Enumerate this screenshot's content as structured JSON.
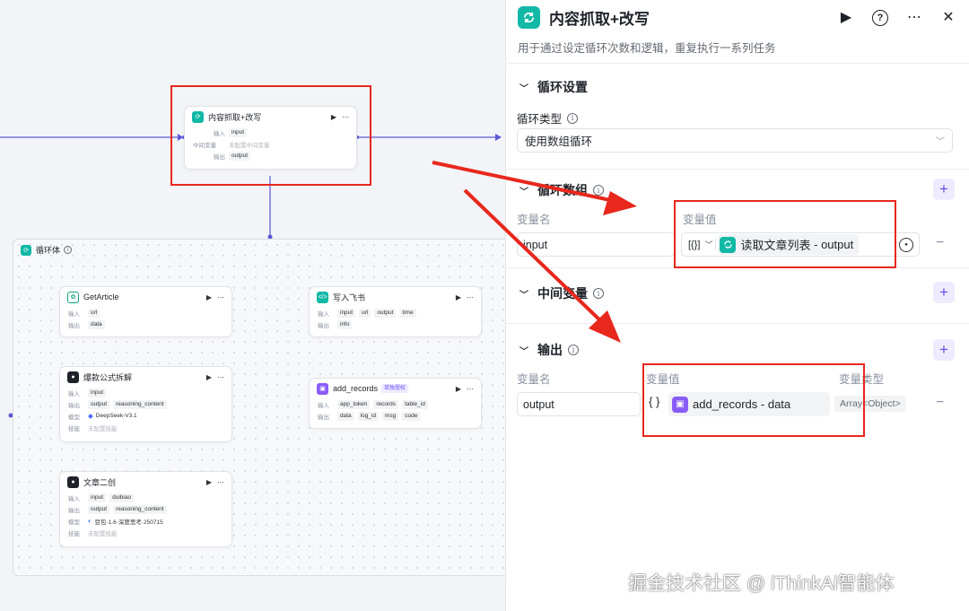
{
  "canvas": {
    "main_node": {
      "title": "内容抓取+改写",
      "input_label": "输入",
      "input_tag": "input",
      "middle_label": "中间变量",
      "middle_value": "未配置中间变量",
      "output_label": "输出",
      "output_tag": "output"
    },
    "loop_body": {
      "title": "循环体"
    },
    "nodes": {
      "get_article": {
        "title": "GetArticle",
        "in_label": "输入",
        "in_tag": "url",
        "out_label": "输出",
        "out_tag": "data"
      },
      "explode": {
        "title": "爆款公式拆解",
        "in_label": "输入",
        "in_tag": "input",
        "out_label": "输出",
        "out_tag1": "output",
        "out_tag2": "reasoning_content",
        "model_label": "模型",
        "model_value": "DeepSeek-V3.1",
        "skill_label": "技能",
        "skill_value": "未配置技能"
      },
      "rewrite": {
        "title": "文章二创",
        "in_label": "输入",
        "in_tag1": "input",
        "in_tag2": "duibiao",
        "out_label": "输出",
        "out_tag1": "output",
        "out_tag2": "reasoning_content",
        "model_label": "模型",
        "model_value": "豆包·1.6·深度思考·250715",
        "skill_label": "技能",
        "skill_value": "未配置技能"
      },
      "feishu": {
        "title": "写入飞书",
        "in_label": "输入",
        "in_tag1": "input",
        "in_tag2": "url",
        "in_tag3": "output",
        "in_tag4": "time",
        "out_label": "输出",
        "out_tag": "info"
      },
      "add_records": {
        "title": "add_records",
        "badge": "单独授权",
        "in_label": "输入",
        "in_tag1": "app_token",
        "in_tag2": "records",
        "in_tag3": "table_id",
        "out_label": "输出",
        "out_tag1": "data",
        "out_tag2": "log_id",
        "out_tag3": "msg",
        "out_tag4": "code"
      }
    }
  },
  "panel": {
    "title": "内容抓取+改写",
    "description": "用于通过设定循环次数和逻辑，重复执行一系列任务",
    "loop_settings": {
      "title": "循环设置",
      "type_label": "循环类型",
      "type_value": "使用数组循环"
    },
    "loop_array": {
      "title": "循环数组",
      "col_name": "变量名",
      "col_value": "变量值",
      "var_name": "input",
      "type_chip": "[{}]",
      "value_source": "读取文章列表",
      "value_sep": " - ",
      "value_field": "output"
    },
    "middle_vars": {
      "title": "中间变量"
    },
    "output": {
      "title": "输出",
      "col_name": "变量名",
      "col_value": "变量值",
      "col_type": "变量类型",
      "var_name": "output",
      "brace": "{ }",
      "value_source": "add_records",
      "value_sep": " - ",
      "value_field": "data",
      "var_type": "Array<Object>"
    }
  },
  "watermark": "掘金技术社区 @ iThinkAi智能体",
  "colors": {
    "accent": "#5b4fe0",
    "teal": "#12b8a6",
    "annotation": "#e8271d",
    "connector": "#5b57d6"
  }
}
